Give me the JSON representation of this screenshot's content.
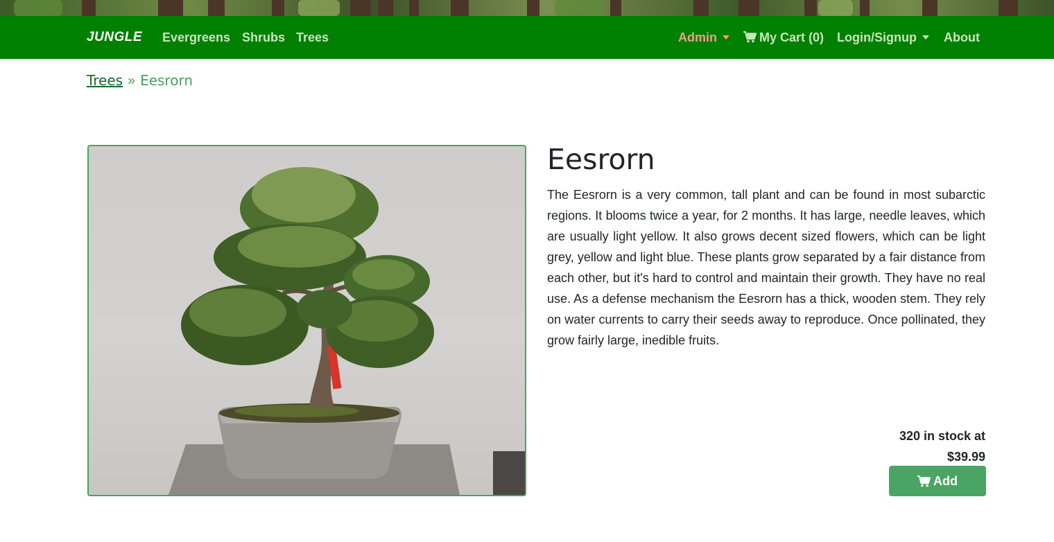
{
  "nav": {
    "brand": "JUNGLE",
    "links": [
      "Evergreens",
      "Shrubs",
      "Trees"
    ],
    "admin": "Admin",
    "cart": "My Cart (0)",
    "login": "Login/Signup",
    "about": "About"
  },
  "breadcrumb": {
    "parent": "Trees",
    "separator": "»",
    "current": "Eesrorn"
  },
  "product": {
    "name": "Eesrorn",
    "description": "The Eesrorn is a very common, tall plant and can be found in most subarctic regions. It blooms twice a year, for 2 months. It has large, needle leaves, which are usually light yellow. It also grows decent sized flowers, which can be light grey, yellow and light blue. These plants grow separated by a fair distance from each other, but it's hard to control and maintain their growth. They have no real use. As a defense mechanism the Eesrorn has a thick, wooden stem. They rely on water currents to carry their seeds away to reproduce. Once pollinated, they grow fairly large, inedible fruits.",
    "stock_line": "320 in stock at",
    "price": "$39.99",
    "add_label": "Add"
  },
  "colors": {
    "navbar": "#008000",
    "accent": "#4aa564",
    "admin": "#f29c8a"
  },
  "icons": [
    "cart-icon",
    "chevron-down-icon"
  ]
}
